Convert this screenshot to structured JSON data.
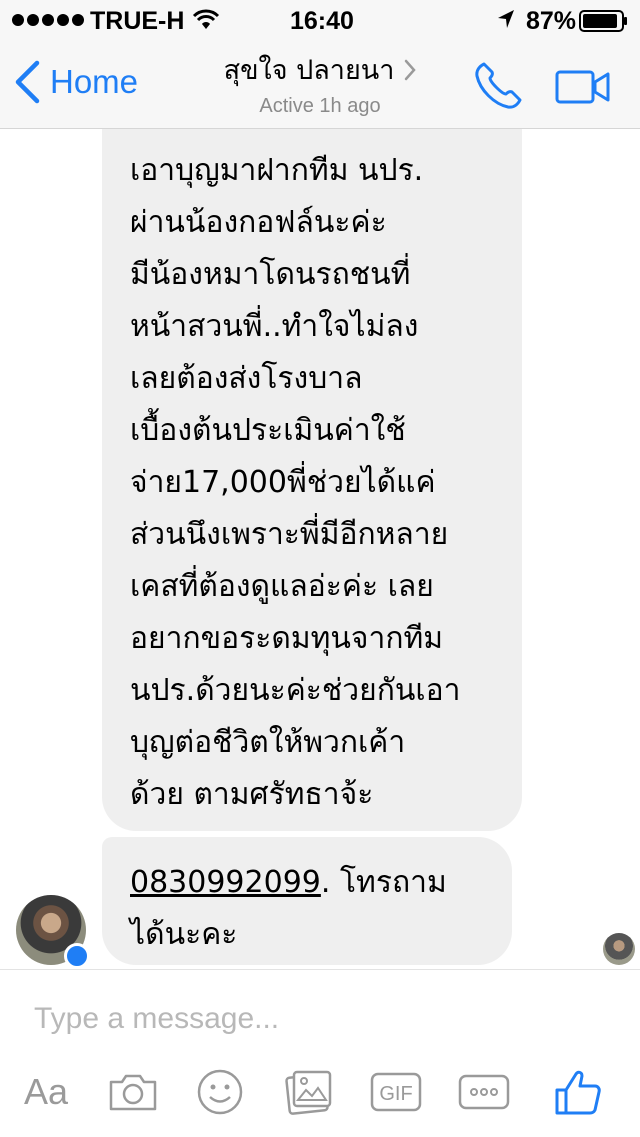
{
  "status_bar": {
    "carrier": "TRUE-H",
    "time": "16:40",
    "battery_percent": "87%"
  },
  "nav": {
    "back_label": "Home",
    "contact_name": "สุขใจ ปลายนา",
    "status": "Active 1h ago"
  },
  "messages": [
    {
      "lines": [
        "เอาบุญมาฝากทีม นปร.",
        "ผ่านน้องกอฟล์นะค่ะ",
        "มีน้องหมาโดนรถชนที่",
        "หน้าสวนพี่..ทำใจไม่ลง",
        "เลยต้องส่งโรงบาล",
        "เบื้องต้นประเมินค่าใช้",
        "จ่าย17,000พี่ช่วยได้แค่",
        "ส่วนนึงเพราะพี่มีอีกหลาย",
        "เคสที่ต้องดูแลอ่ะค่ะ เลย",
        "อยากขอระดมทุนจากทีม",
        "นปร.ด้วยนะค่ะช่วยกันเอา",
        "บุญต่อชีวิตให้พวกเค้า",
        "ด้วย ตามศรัทธาจ้ะ"
      ]
    },
    {
      "phone": "0830992099",
      "after_phone": ". โทรถาม",
      "line2": "ได้นะคะ"
    }
  ],
  "composer": {
    "placeholder": "Type a message...",
    "aa_label": "Aa",
    "gif_label": "GIF"
  },
  "colors": {
    "accent": "#1f7ef5",
    "bubble": "#efefef",
    "bar_bg": "#f7f7f7"
  },
  "icons": [
    "signal-dots-icon",
    "wifi-icon",
    "location-arrow-icon",
    "battery-icon",
    "chevron-left-icon",
    "chevron-right-icon",
    "phone-icon",
    "video-camera-icon",
    "messenger-badge-icon",
    "camera-icon",
    "emoji-icon",
    "photo-icon",
    "gif-icon",
    "more-icon",
    "thumbs-up-icon"
  ]
}
